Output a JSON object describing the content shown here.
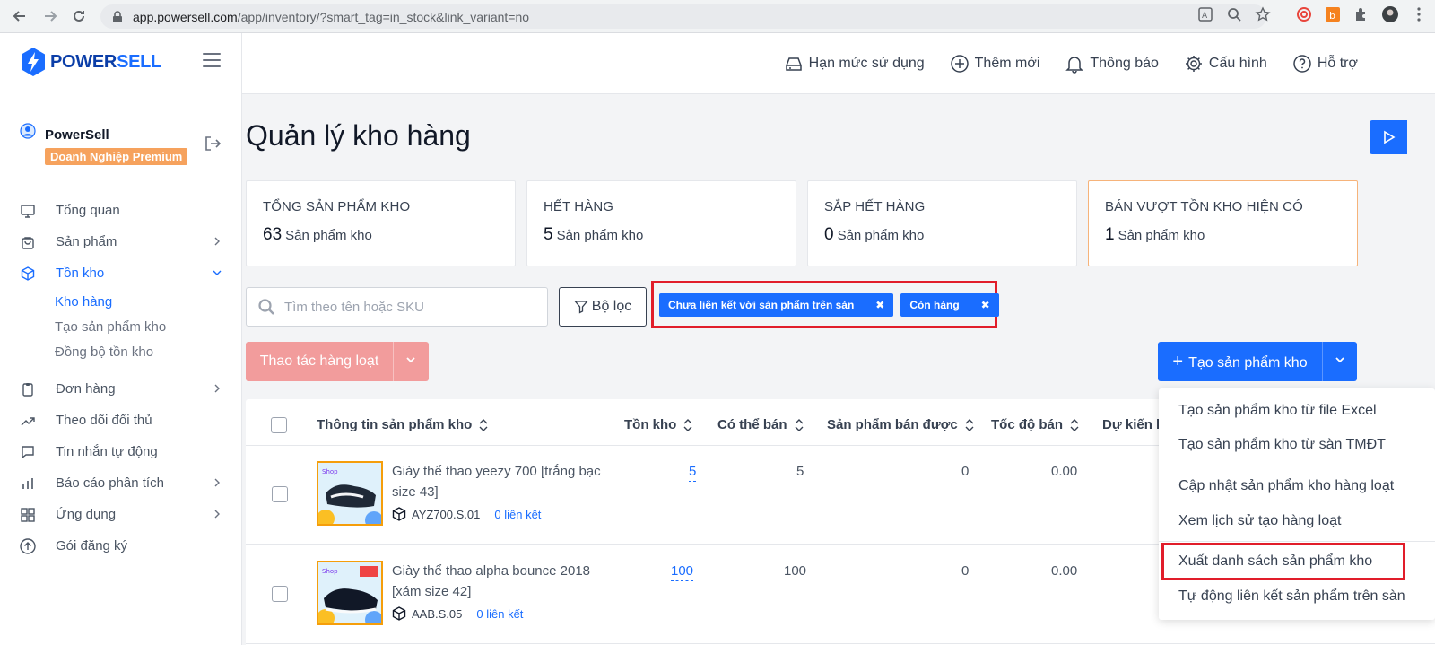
{
  "browser": {
    "url_host": "app.powersell.com",
    "url_path": "/app/inventory/?smart_tag=in_stock&link_variant=no"
  },
  "brand": {
    "name_part1": "POWER",
    "name_part2": "SELL",
    "color": "#1a6dff"
  },
  "user": {
    "name": "PowerSell",
    "plan": "Doanh Nghiệp Premium"
  },
  "sidebar": {
    "items": [
      {
        "label": "Tổng quan",
        "icon": "monitor-icon"
      },
      {
        "label": "Sản phẩm",
        "icon": "bag-icon"
      },
      {
        "label": "Tồn kho",
        "icon": "box-icon"
      },
      {
        "label": "Đơn hàng",
        "icon": "clipboard-icon"
      },
      {
        "label": "Theo dõi đối thủ",
        "icon": "trend-icon"
      },
      {
        "label": "Tin nhắn tự động",
        "icon": "chat-icon"
      },
      {
        "label": "Báo cáo phân tích",
        "icon": "bar-chart-icon"
      },
      {
        "label": "Ứng dụng",
        "icon": "grid-icon"
      },
      {
        "label": "Gói đăng ký",
        "icon": "upload-circle-icon"
      }
    ],
    "submenu": [
      "Kho hàng",
      "Tạo sản phẩm kho",
      "Đồng bộ tồn kho"
    ]
  },
  "topbar": {
    "usage": "Hạn mức sử dụng",
    "add_new": "Thêm mới",
    "notifications": "Thông báo",
    "settings": "Cấu hình",
    "support": "Hỗ trợ"
  },
  "page": {
    "title": "Quản lý kho hàng"
  },
  "stats": [
    {
      "label": "TỔNG SẢN PHẨM KHO",
      "value": "63",
      "unit": "Sản phẩm kho"
    },
    {
      "label": "HẾT HÀNG",
      "value": "5",
      "unit": "Sản phẩm kho"
    },
    {
      "label": "SẮP HẾT HÀNG",
      "value": "0",
      "unit": "Sản phẩm kho"
    },
    {
      "label": "BÁN VƯỢT TỒN KHO HIỆN CÓ",
      "value": "1",
      "unit": "Sản phẩm kho"
    }
  ],
  "search": {
    "placeholder": "Tìm theo tên hoặc SKU"
  },
  "filter": {
    "label": "Bộ lọc"
  },
  "tags": [
    {
      "label": "Chưa liên kết với sản phẩm trên sàn",
      "remove": "✖"
    },
    {
      "label": "Còn hàng",
      "remove": "✖"
    }
  ],
  "bulk_action": {
    "label": "Thao tác hàng loạt"
  },
  "create_button": {
    "label": "Tạo sản phẩm kho"
  },
  "table": {
    "columns": [
      "Thông tin sản phẩm kho",
      "Tồn kho",
      "Có thể bán",
      "Sản phẩm bán được",
      "Tốc độ bán",
      "Dự kiến h"
    ],
    "rows": [
      {
        "name": "Giày thể thao yeezy 700 [trắng bạc size 43]",
        "sku": "AYZ700.S.01",
        "links": "0 liên kết",
        "stock": "5",
        "available": "5",
        "sold": "0",
        "speed": "0.00"
      },
      {
        "name": "Giày thể thao alpha bounce 2018 [xám size 42]",
        "sku": "AAB.S.05",
        "links": "0 liên kết",
        "stock": "100",
        "available": "100",
        "sold": "0",
        "speed": "0.00"
      }
    ]
  },
  "dropdown": {
    "items": [
      "Tạo sản phẩm kho từ file Excel",
      "Tạo sản phẩm kho từ sàn TMĐT",
      "Cập nhật sản phẩm kho hàng loạt",
      "Xem lịch sử tạo hàng loạt",
      "Xuất danh sách sản phẩm kho",
      "Tự động liên kết sản phẩm trên sàn"
    ]
  }
}
